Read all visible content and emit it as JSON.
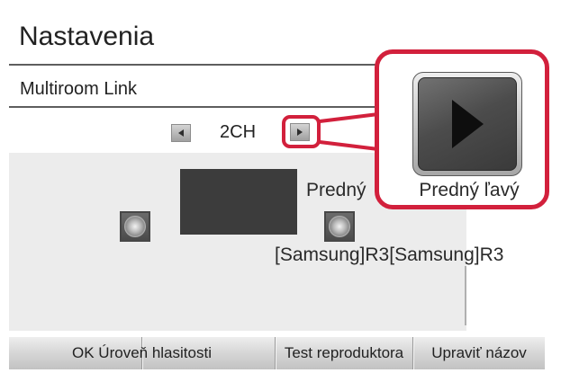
{
  "header": {
    "title": "Nastavenia",
    "subtitle": "Multiroom Link"
  },
  "channel_selector": {
    "value": "2CH",
    "prev_icon": "arrow-left-icon",
    "next_icon": "arrow-right-icon"
  },
  "layout_view": {
    "front_label": "Predný",
    "speaker_name": "[Samsung]R3[Samsung]R3",
    "speaker_icon": "speaker-icon"
  },
  "callout": {
    "icon": "play-icon",
    "label": "Predný ľavý"
  },
  "footer": {
    "buttons": [
      {
        "label": "OK Úroveň hlasitosti"
      },
      {
        "label": "Test reproduktora"
      },
      {
        "label": "Upraviť názov"
      }
    ]
  },
  "colors": {
    "highlight": "#d2203c",
    "panel": "#ececec",
    "display": "#3c3c3c",
    "text": "#222222"
  }
}
